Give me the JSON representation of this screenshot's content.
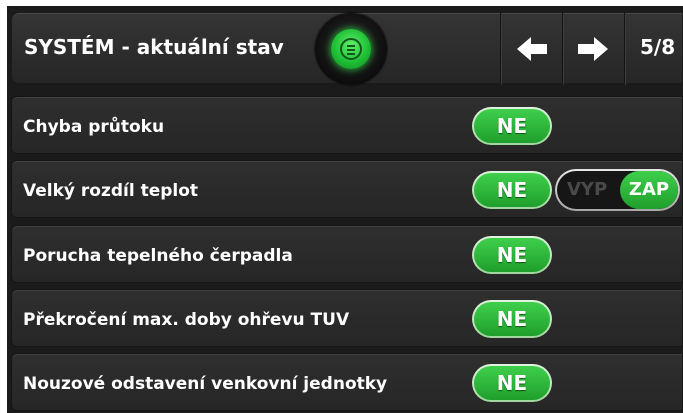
{
  "header": {
    "title": "SYSTÉM - aktuální stav",
    "menu_icon": "menu-list-icon",
    "prev_icon": "arrow-left-icon",
    "next_icon": "arrow-right-icon",
    "page_indicator": "5/8"
  },
  "rows": [
    {
      "label": "Chyba průtoku",
      "value": "NE"
    },
    {
      "label": "Velký rozdíl teplot",
      "value": "NE",
      "toggle": {
        "off_label": "VYP",
        "on_label": "ZAP",
        "state": "on"
      }
    },
    {
      "label": "Porucha tepelného čerpadla",
      "value": "NE"
    },
    {
      "label": "Překročení max. doby ohřevu TUV",
      "value": "NE"
    },
    {
      "label": "Nouzové odstavení venkovní jednotky",
      "value": "NE"
    }
  ],
  "colors": {
    "accent_green": "#2fbf3c",
    "background": "#1b1b1b",
    "panel": "#2b2b2b",
    "text": "#ffffff"
  }
}
